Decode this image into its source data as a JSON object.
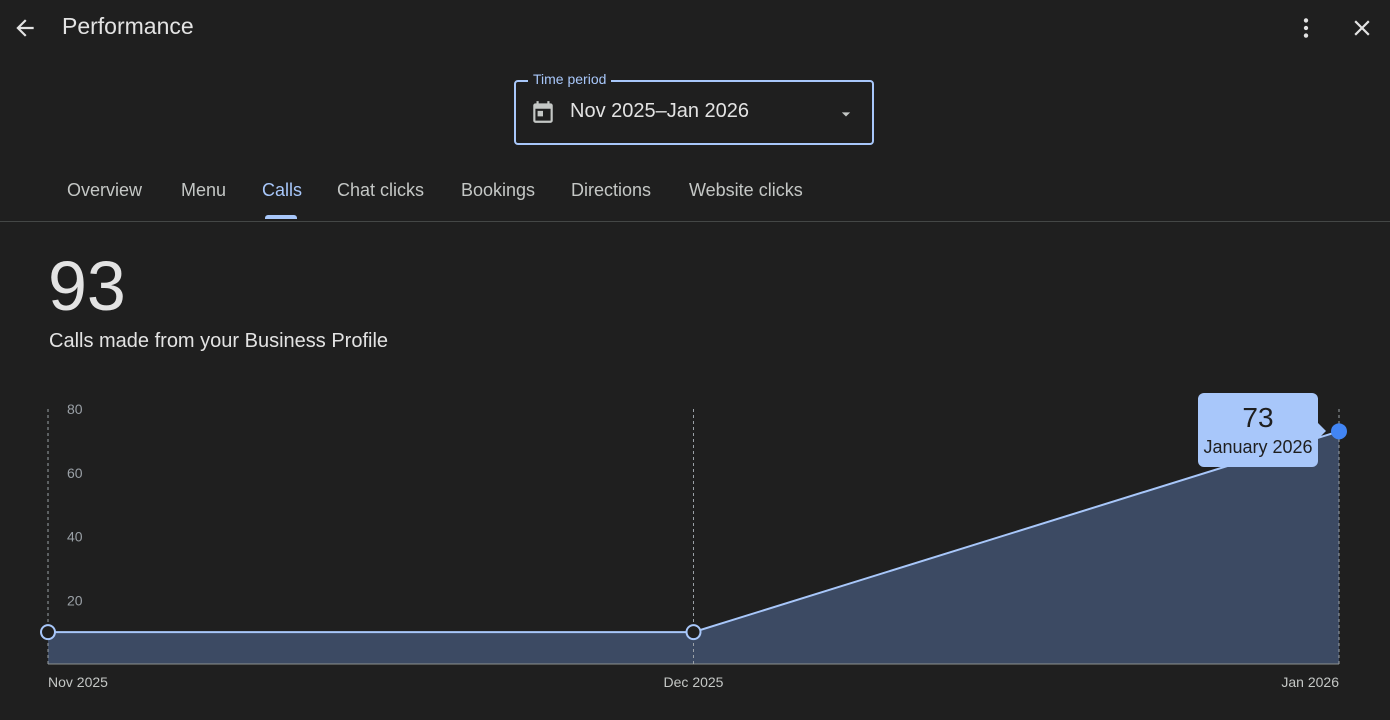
{
  "header": {
    "title": "Performance",
    "back_icon": "arrow-back-icon",
    "more_icon": "more-vert-icon",
    "close_icon": "close-icon"
  },
  "time_period": {
    "label": "Time period",
    "value": "Nov 2025–Jan 2026",
    "icon": "calendar-icon"
  },
  "tabs": [
    {
      "label": "Overview",
      "active": false
    },
    {
      "label": "Menu",
      "active": false
    },
    {
      "label": "Calls",
      "active": true
    },
    {
      "label": "Chat clicks",
      "active": false
    },
    {
      "label": "Bookings",
      "active": false
    },
    {
      "label": "Directions",
      "active": false
    },
    {
      "label": "Website clicks",
      "active": false
    }
  ],
  "metric": {
    "value": "93",
    "caption": "Calls made from your Business Profile"
  },
  "tooltip": {
    "value": "73",
    "label": "January 2026"
  },
  "colors": {
    "accent": "#a8c7fa",
    "point": "#4285f4",
    "area": "#3c4a63",
    "background": "#1f1f1f"
  },
  "chart_data": {
    "type": "area",
    "x": [
      "Nov 2025",
      "Dec 2025",
      "Jan 2026"
    ],
    "series": [
      {
        "values": [
          10,
          10,
          73
        ]
      }
    ],
    "yticks": [
      20,
      40,
      60,
      80
    ],
    "ylim": [
      0,
      80
    ],
    "title": "",
    "xlabel": "",
    "ylabel": "",
    "grid": "vertical dashed",
    "highlighted_point": "Jan 2026"
  }
}
